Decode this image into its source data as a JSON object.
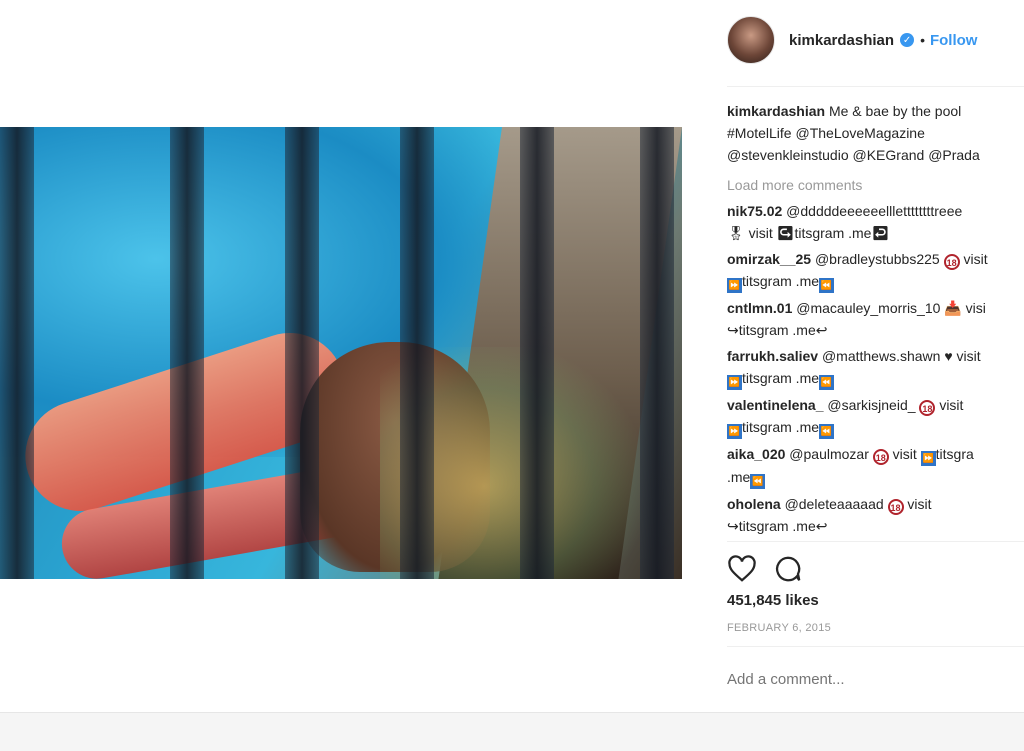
{
  "post": {
    "username": "kimkardashian",
    "separator": "•",
    "follow_label": "Follow",
    "caption": {
      "line1": "Me & bae by the pool",
      "line2": "#MotelLife @TheLoveMagazine",
      "line3": "@stevenkleinstudio @KEGrand @Prada"
    },
    "load_more": "Load more comments",
    "likes": "451,845 likes",
    "date": "FEBRUARY 6, 2015",
    "add_comment_placeholder": "Add a comment..."
  },
  "comments": [
    {
      "user": "nik75.02",
      "text1": "@dddddeeeeeelllettttttttreee",
      "text2": "visit ↪titsgram .me↩"
    },
    {
      "user": "omirzak__25",
      "text1": "@bradleystubbs225",
      "tail": "visit",
      "text2": "titsgram .me"
    },
    {
      "user": "cntlmn.01",
      "text1": "@macauley_morris_10",
      "tail": "visi",
      "text2": "↪titsgram .me↩"
    },
    {
      "user": "farrukh.saliev",
      "text1": "@matthews.shawn",
      "tail": "visit",
      "text2": "titsgram .me"
    },
    {
      "user": "valentinelena_",
      "text1": "@sarkisjneid_",
      "tail": "visit",
      "text2": "titsgram .me"
    },
    {
      "user": "aika_020",
      "text1": "@paulmozar",
      "tail": "visit",
      "tail2": "titsgra",
      "text2": ".me"
    },
    {
      "user": "oholena",
      "text1": "@deleteaaaaad",
      "tail": "visit",
      "text2": "↪titsgram .me↩"
    }
  ],
  "icons": {
    "verified": "verified-badge-icon",
    "like": "heart-icon",
    "comment": "comment-bubble-icon",
    "badge18": "18-plus-icon",
    "media": "fast-forward-icon"
  },
  "badge_text": "18",
  "colors": {
    "link_blue": "#3897f0",
    "muted": "#999999",
    "text": "#262626"
  }
}
